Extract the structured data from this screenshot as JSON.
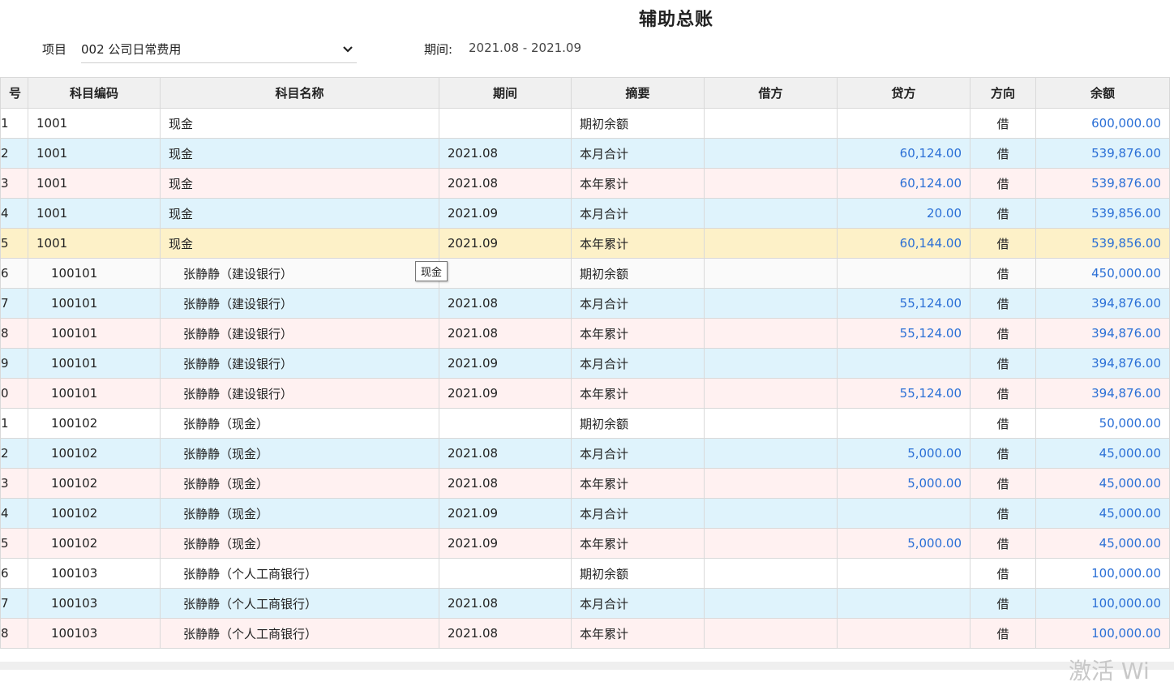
{
  "title": "辅助总账",
  "filter": {
    "label": "项目",
    "value": "002 公司日常费用",
    "chevron_icon": "chevron-down-icon"
  },
  "period": {
    "label": "期间:",
    "value": "2021.08 - 2021.09"
  },
  "table": {
    "headers": [
      "号",
      "科目编码",
      "科目名称",
      "期间",
      "摘要",
      "借方",
      "贷方",
      "方向",
      "余额"
    ],
    "rows": [
      {
        "idx": "1",
        "code": "1001",
        "name": "现金",
        "period": "",
        "summary": "期初余额",
        "debit": "",
        "credit": "",
        "dir": "借",
        "balance": "600,000.00",
        "bg": "white",
        "indent": false
      },
      {
        "idx": "2",
        "code": "1001",
        "name": "现金",
        "period": "2021.08",
        "summary": "本月合计",
        "debit": "",
        "credit": "60,124.00",
        "dir": "借",
        "balance": "539,876.00",
        "bg": "blue",
        "indent": false
      },
      {
        "idx": "3",
        "code": "1001",
        "name": "现金",
        "period": "2021.08",
        "summary": "本年累计",
        "debit": "",
        "credit": "60,124.00",
        "dir": "借",
        "balance": "539,876.00",
        "bg": "pink",
        "indent": false
      },
      {
        "idx": "4",
        "code": "1001",
        "name": "现金",
        "period": "2021.09",
        "summary": "本月合计",
        "debit": "",
        "credit": "20.00",
        "dir": "借",
        "balance": "539,856.00",
        "bg": "blue",
        "indent": false
      },
      {
        "idx": "5",
        "code": "1001",
        "name": "现金",
        "period": "2021.09",
        "summary": "本年累计",
        "debit": "",
        "credit": "60,144.00",
        "dir": "借",
        "balance": "539,856.00",
        "bg": "yellow",
        "indent": false
      },
      {
        "idx": "6",
        "code": "100101",
        "name": "张静静（建设银行）",
        "period": "",
        "summary": "期初余额",
        "debit": "",
        "credit": "",
        "dir": "借",
        "balance": "450,000.00",
        "bg": "gray",
        "indent": true
      },
      {
        "idx": "7",
        "code": "100101",
        "name": "张静静（建设银行）",
        "period": "2021.08",
        "summary": "本月合计",
        "debit": "",
        "credit": "55,124.00",
        "dir": "借",
        "balance": "394,876.00",
        "bg": "blue",
        "indent": true
      },
      {
        "idx": "8",
        "code": "100101",
        "name": "张静静（建设银行）",
        "period": "2021.08",
        "summary": "本年累计",
        "debit": "",
        "credit": "55,124.00",
        "dir": "借",
        "balance": "394,876.00",
        "bg": "pink",
        "indent": true
      },
      {
        "idx": "9",
        "code": "100101",
        "name": "张静静（建设银行）",
        "period": "2021.09",
        "summary": "本月合计",
        "debit": "",
        "credit": "",
        "dir": "借",
        "balance": "394,876.00",
        "bg": "blue",
        "indent": true
      },
      {
        "idx": "0",
        "code": "100101",
        "name": "张静静（建设银行）",
        "period": "2021.09",
        "summary": "本年累计",
        "debit": "",
        "credit": "55,124.00",
        "dir": "借",
        "balance": "394,876.00",
        "bg": "pink",
        "indent": true
      },
      {
        "idx": "1",
        "code": "100102",
        "name": "张静静（现金）",
        "period": "",
        "summary": "期初余额",
        "debit": "",
        "credit": "",
        "dir": "借",
        "balance": "50,000.00",
        "bg": "white",
        "indent": true
      },
      {
        "idx": "2",
        "code": "100102",
        "name": "张静静（现金）",
        "period": "2021.08",
        "summary": "本月合计",
        "debit": "",
        "credit": "5,000.00",
        "dir": "借",
        "balance": "45,000.00",
        "bg": "blue",
        "indent": true
      },
      {
        "idx": "3",
        "code": "100102",
        "name": "张静静（现金）",
        "period": "2021.08",
        "summary": "本年累计",
        "debit": "",
        "credit": "5,000.00",
        "dir": "借",
        "balance": "45,000.00",
        "bg": "pink",
        "indent": true
      },
      {
        "idx": "4",
        "code": "100102",
        "name": "张静静（现金）",
        "period": "2021.09",
        "summary": "本月合计",
        "debit": "",
        "credit": "",
        "dir": "借",
        "balance": "45,000.00",
        "bg": "blue",
        "indent": true
      },
      {
        "idx": "5",
        "code": "100102",
        "name": "张静静（现金）",
        "period": "2021.09",
        "summary": "本年累计",
        "debit": "",
        "credit": "5,000.00",
        "dir": "借",
        "balance": "45,000.00",
        "bg": "pink",
        "indent": true
      },
      {
        "idx": "6",
        "code": "100103",
        "name": "张静静（个人工商银行）",
        "period": "",
        "summary": "期初余额",
        "debit": "",
        "credit": "",
        "dir": "借",
        "balance": "100,000.00",
        "bg": "white",
        "indent": true
      },
      {
        "idx": "7",
        "code": "100103",
        "name": "张静静（个人工商银行）",
        "period": "2021.08",
        "summary": "本月合计",
        "debit": "",
        "credit": "",
        "dir": "借",
        "balance": "100,000.00",
        "bg": "blue",
        "indent": true
      },
      {
        "idx": "8",
        "code": "100103",
        "name": "张静静（个人工商银行）",
        "period": "2021.08",
        "summary": "本年累计",
        "debit": "",
        "credit": "",
        "dir": "借",
        "balance": "100,000.00",
        "bg": "pink",
        "indent": true
      }
    ]
  },
  "tooltip": "现金",
  "watermark": "激活 Wi",
  "colors": {
    "amount_blue": "#2a6fd6",
    "row_blue": "#dff3fc",
    "row_pink": "#fff1f1",
    "row_yellow": "#fdf1c8",
    "header_bg": "#f0f0f0"
  }
}
